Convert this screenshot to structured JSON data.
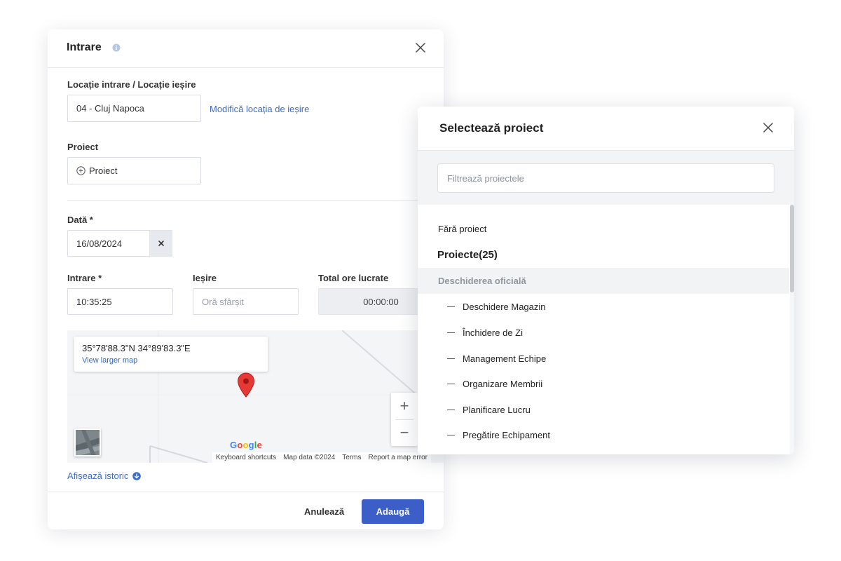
{
  "entry_dialog": {
    "title": "Intrare",
    "location": {
      "label": "Locație intrare / Locație ieșire",
      "value": "04 - Cluj Napoca",
      "edit_exit_link": "Modifică locația de ieșire"
    },
    "project": {
      "label": "Proiect",
      "button_label": "Proiect"
    },
    "date": {
      "label": "Dată *",
      "value": "16/08/2024"
    },
    "time_in": {
      "label": "Intrare *",
      "value": "10:35:25"
    },
    "time_out": {
      "label": "Ieșire",
      "placeholder": "Oră sfârșit"
    },
    "total_hours": {
      "label": "Total ore lucrate",
      "value": "00:00:00"
    },
    "map": {
      "coordinates": "35°78'88.3\"N 34°89'83.3\"E",
      "view_larger": "View larger map",
      "zoom_in": "+",
      "zoom_out": "−",
      "logo": "Google",
      "footer": [
        "Keyboard shortcuts",
        "Map data ©2024",
        "Terms",
        "Report a map error"
      ]
    },
    "show_history": "Afișează istoric",
    "cancel": "Anulează",
    "add": "Adaugă"
  },
  "project_picker": {
    "title": "Selectează proiect",
    "filter_placeholder": "Filtrează proiectele",
    "no_project": "Fără proiect",
    "projects_header": "Proiecte(25)",
    "group": "Deschiderea oficială",
    "items": [
      "Deschidere Magazin",
      "Închidere de Zi",
      "Management Echipe",
      "Organizare Membrii",
      "Planificare Lucru",
      "Pregătire Echipament"
    ]
  },
  "colors": {
    "primary": "#3b5fc7",
    "link": "#3c6bc9",
    "marker": "#e53935"
  }
}
